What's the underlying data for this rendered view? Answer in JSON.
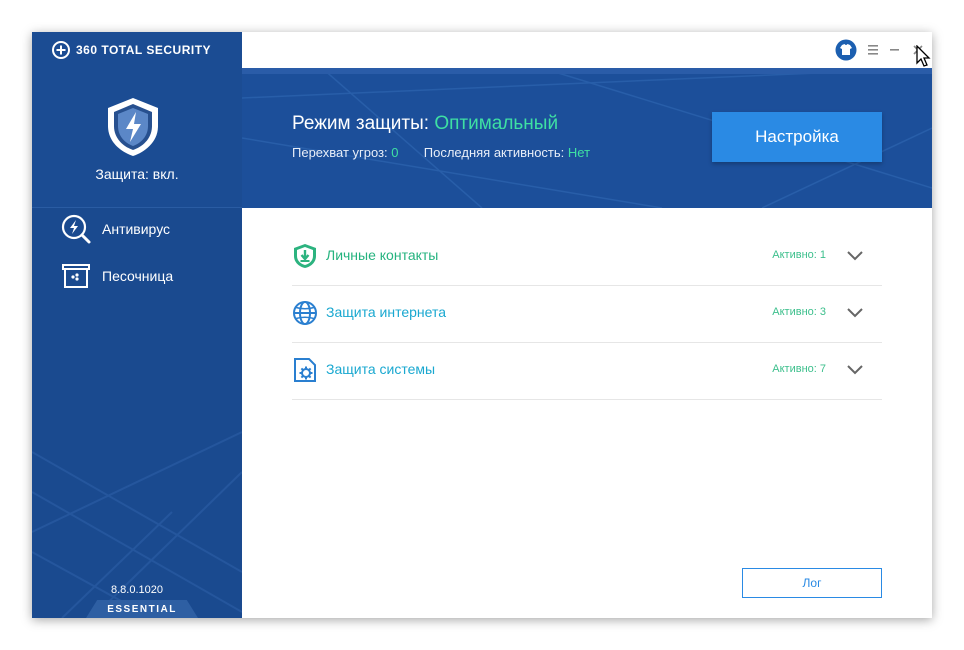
{
  "app": {
    "brand": "360 TOTAL SECURITY",
    "version": "8.8.0.1020",
    "edition": "ESSENTIAL"
  },
  "sidebar": {
    "protection_status": "Защита: вкл.",
    "items": [
      {
        "label": "Антивирус",
        "icon": "antivirus-icon"
      },
      {
        "label": "Песочница",
        "icon": "sandbox-icon"
      }
    ]
  },
  "titlebar": {
    "icons": [
      "skin-icon",
      "menu-icon",
      "minimize-icon",
      "close-icon"
    ]
  },
  "header": {
    "mode_label": "Режим защиты:",
    "mode_value": "Оптимальный",
    "intercept_label": "Перехват угроз:",
    "intercept_value": "0",
    "activity_label": "Последняя активность:",
    "activity_value": "Нет",
    "settings_button": "Настройка"
  },
  "modules": [
    {
      "label": "Личные контакты",
      "status": "Активно: 1",
      "icon": "contacts-shield-icon"
    },
    {
      "label": "Защита интернета",
      "status": "Активно: 3",
      "icon": "globe-icon"
    },
    {
      "label": "Защита системы",
      "status": "Активно: 7",
      "icon": "system-gear-icon"
    }
  ],
  "footer": {
    "log_button": "Лог"
  },
  "colors": {
    "sidebar": "#1a4a8f",
    "header": "#1c4f9a",
    "accent_green": "#3ee0a3",
    "button_blue": "#2a8ae4"
  }
}
